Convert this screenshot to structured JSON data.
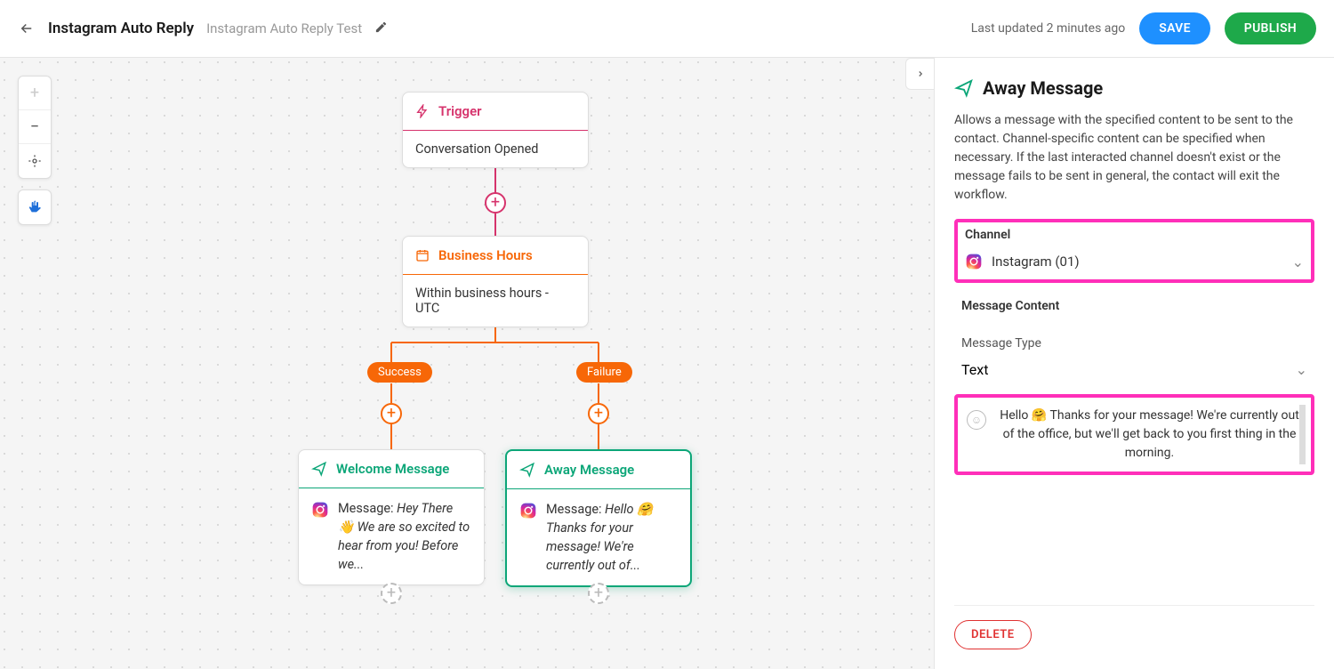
{
  "header": {
    "title": "Instagram Auto Reply",
    "subtitle": "Instagram Auto Reply Test",
    "updated": "Last updated 2 minutes ago",
    "save": "SAVE",
    "publish": "PUBLISH"
  },
  "nodes": {
    "trigger": {
      "title": "Trigger",
      "body": "Conversation Opened"
    },
    "biz": {
      "title": "Business Hours",
      "body": "Within business hours - UTC"
    },
    "welcome": {
      "title": "Welcome Message",
      "label": "Message: ",
      "text": "Hey There 👋 We are so excited to hear from you! Before we..."
    },
    "away": {
      "title": "Away Message",
      "label": "Message: ",
      "text": "Hello 🤗 Thanks for your message! We're currently out of..."
    }
  },
  "pills": {
    "success": "Success",
    "failure": "Failure"
  },
  "sidebar": {
    "title": "Away Message",
    "desc": "Allows a message with the specified content to be sent to the contact. Channel-specific content can be specified when necessary. If the last interacted channel doesn't exist or the message fails to be sent in general, the contact will exit the workflow.",
    "channel_label": "Channel",
    "channel_value": "Instagram (01)",
    "content_label": "Message Content",
    "type_label": "Message Type",
    "type_value": "Text",
    "message_text": "Hello 🤗 Thanks for your message! We're currently out of the office, but we'll get back to you first thing in the morning.",
    "delete": "DELETE"
  }
}
